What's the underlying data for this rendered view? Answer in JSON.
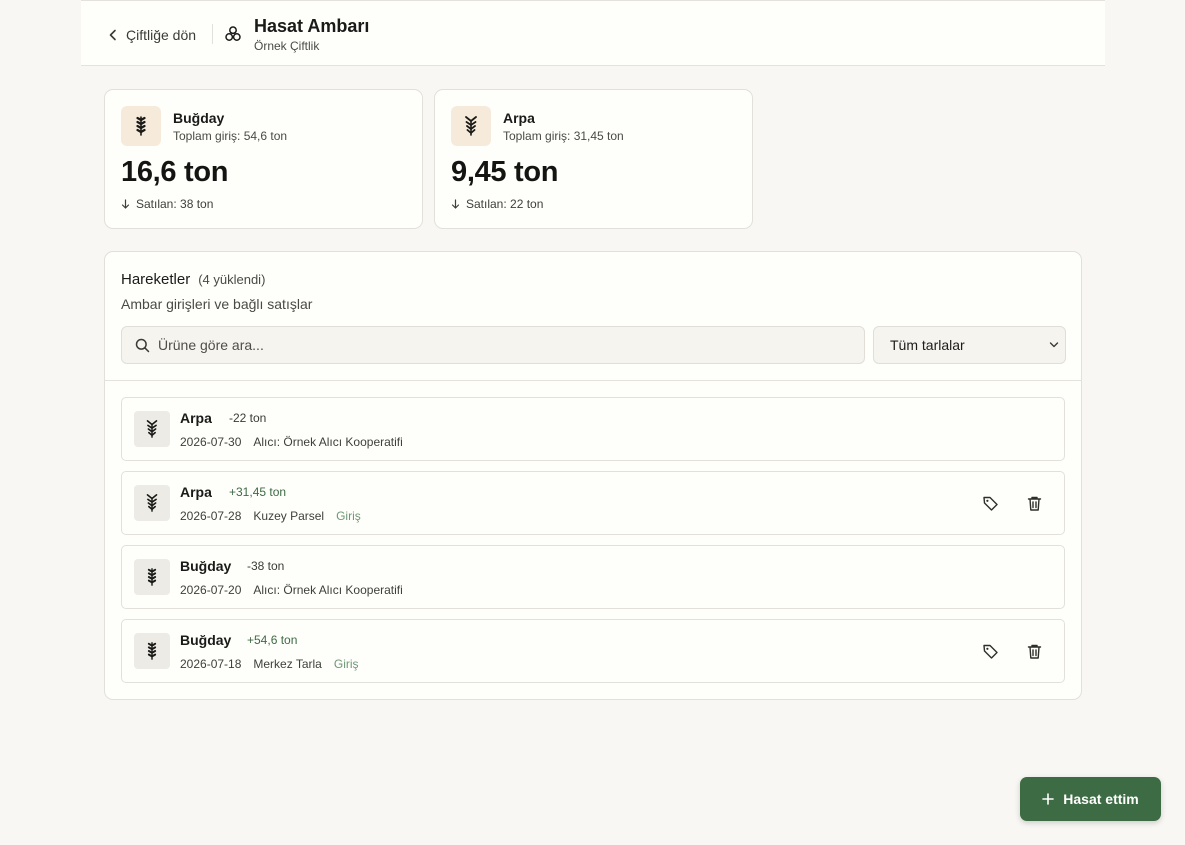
{
  "header": {
    "back_label": "Çiftliğe dön",
    "title": "Hasat Ambarı",
    "subtitle": "Örnek Çiftlik"
  },
  "stats": [
    {
      "product": "Buğday",
      "total": "Toplam giriş: 54,6 ton",
      "value": "16,6 ton",
      "sold": "Satılan: 38 ton",
      "icon": "wheat-icon"
    },
    {
      "product": "Arpa",
      "total": "Toplam giriş: 31,45 ton",
      "value": "9,45 ton",
      "sold": "Satılan: 22 ton",
      "icon": "barley-icon"
    }
  ],
  "movements": {
    "title": "Hareketler",
    "count": "(4 yüklendi)",
    "description": "Ambar girişleri ve bağlı satışlar",
    "search_placeholder": "Ürüne göre ara...",
    "filter_selected": "Tüm tarlalar",
    "rows": [
      {
        "product": "Arpa",
        "qty": "-22 ton",
        "date": "2026-07-30",
        "detail": "Alıcı: Örnek Alıcı Kooperatifi",
        "tag": "",
        "icon": "barley-icon"
      },
      {
        "product": "Arpa",
        "qty": "+31,45 ton",
        "date": "2026-07-28",
        "detail": "Kuzey Parsel",
        "tag": "Giriş",
        "icon": "barley-icon"
      },
      {
        "product": "Buğday",
        "qty": "-38 ton",
        "date": "2026-07-20",
        "detail": "Alıcı: Örnek Alıcı Kooperatifi",
        "tag": "",
        "icon": "wheat-icon"
      },
      {
        "product": "Buğday",
        "qty": "+54,6 ton",
        "date": "2026-07-18",
        "detail": "Merkez Tarla",
        "tag": "Giriş",
        "icon": "wheat-icon"
      }
    ]
  },
  "fab": {
    "label": "Hasat ettim"
  },
  "colors": {
    "accent": "#3d6b43",
    "background": "#f8f7f3",
    "card": "#fefefb",
    "border": "#e2e0da",
    "stat_icon_bg": "#f6ebdb",
    "row_icon_bg": "#ecebe6",
    "entry_tag": "#6f9775"
  }
}
